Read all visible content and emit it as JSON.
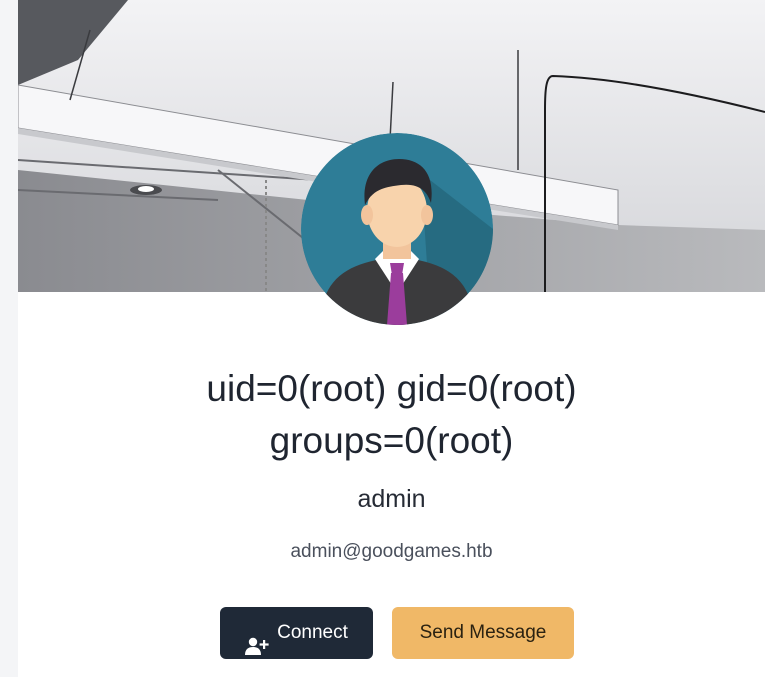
{
  "profile": {
    "title_line1": "uid=0(root) gid=0(root)",
    "title_line2": "groups=0(root)",
    "username": "admin",
    "email": "admin@goodgames.htb"
  },
  "actions": {
    "connect_label": "Connect",
    "connect_icon": "user-plus-icon",
    "message_label": "Send Message"
  },
  "colors": {
    "connect_bg": "#1f2937",
    "message_bg": "#f0b867",
    "avatar_bg": "#2e7d97"
  }
}
